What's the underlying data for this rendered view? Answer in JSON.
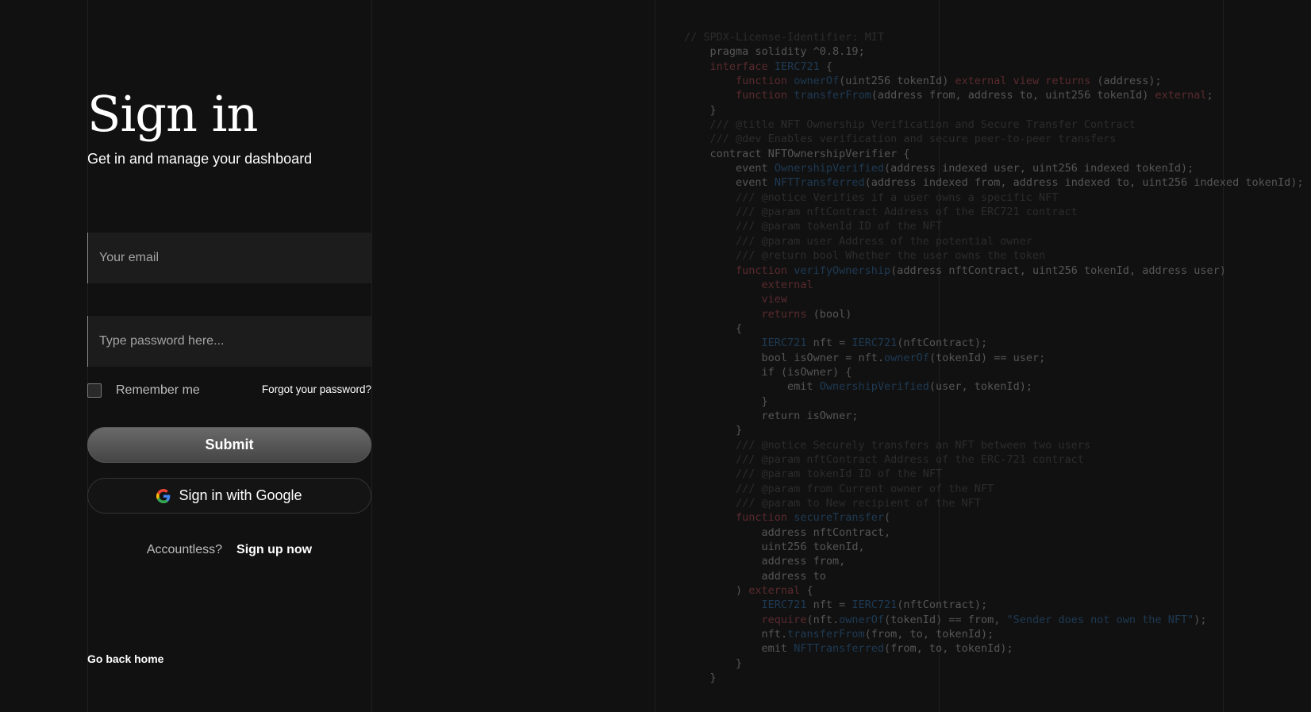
{
  "page": {
    "title": "Sign in",
    "subtitle": "Get in and manage your dashboard"
  },
  "form": {
    "email_placeholder": "Your email",
    "password_placeholder": "Type password here...",
    "remember_label": "Remember me",
    "remember_checked": false,
    "forgot_label": "Forgot your password?",
    "submit_label": "Submit",
    "google_label": "Sign in with Google",
    "account_prompt": "Accountless?",
    "signup_label": "Sign up now"
  },
  "footer": {
    "back_home_label": "Go back home"
  },
  "colors": {
    "background": "#111111",
    "text": "#ffffff",
    "muted_text": "#bdbdbd",
    "input_background": "#1c1c1c",
    "submit_gradient_top": "#696969",
    "submit_gradient_bottom": "#454545"
  },
  "icons": {
    "google": "google-g-icon"
  },
  "code_lines": [
    "// SPDX-License-Identifier: MIT",
    "    pragma solidity ^0.8.19;",
    "    interface IERC721 {",
    "        function ownerOf(uint256 tokenId) external view returns (address);",
    "        function transferFrom(address from, address to, uint256 tokenId) external;",
    "    }",
    "    /// @title NFT Ownership Verification and Secure Transfer Contract",
    "    /// @dev Enables verification and secure peer-to-peer transfers",
    "    contract NFTOwnershipVerifier {",
    "        event OwnershipVerified(address indexed user, uint256 indexed tokenId);",
    "        event NFTTransferred(address indexed from, address indexed to, uint256 indexed tokenId);",
    "        /// @notice Verifies if a user owns a specific NFT",
    "        /// @param nftContract Address of the ERC721 contract",
    "        /// @param tokenId ID of the NFT",
    "        /// @param user Address of the potential owner",
    "        /// @return bool Whether the user owns the token",
    "        function verifyOwnership(address nftContract, uint256 tokenId, address user)",
    "            external",
    "            view",
    "            returns (bool)",
    "        {",
    "            IERC721 nft = IERC721(nftContract);",
    "            bool isOwner = nft.ownerOf(tokenId) == user;",
    "            if (isOwner) {",
    "                emit OwnershipVerified(user, tokenId);",
    "            }",
    "            return isOwner;",
    "        }",
    "        /// @notice Securely transfers an NFT between two users",
    "        /// @param nftContract Address of the ERC-721 contract",
    "        /// @param tokenId ID of the NFT",
    "        /// @param from Current owner of the NFT",
    "        /// @param to New recipient of the NFT",
    "        function secureTransfer(",
    "            address nftContract,",
    "            uint256 tokenId,",
    "            address from,",
    "            address to",
    "        ) external {",
    "            IERC721 nft = IERC721(nftContract);",
    "            require(nft.ownerOf(tokenId) == from, \"Sender does not own the NFT\");",
    "            nft.transferFrom(from, to, tokenId);",
    "            emit NFTTransferred(from, to, tokenId);",
    "        }",
    "    }"
  ]
}
